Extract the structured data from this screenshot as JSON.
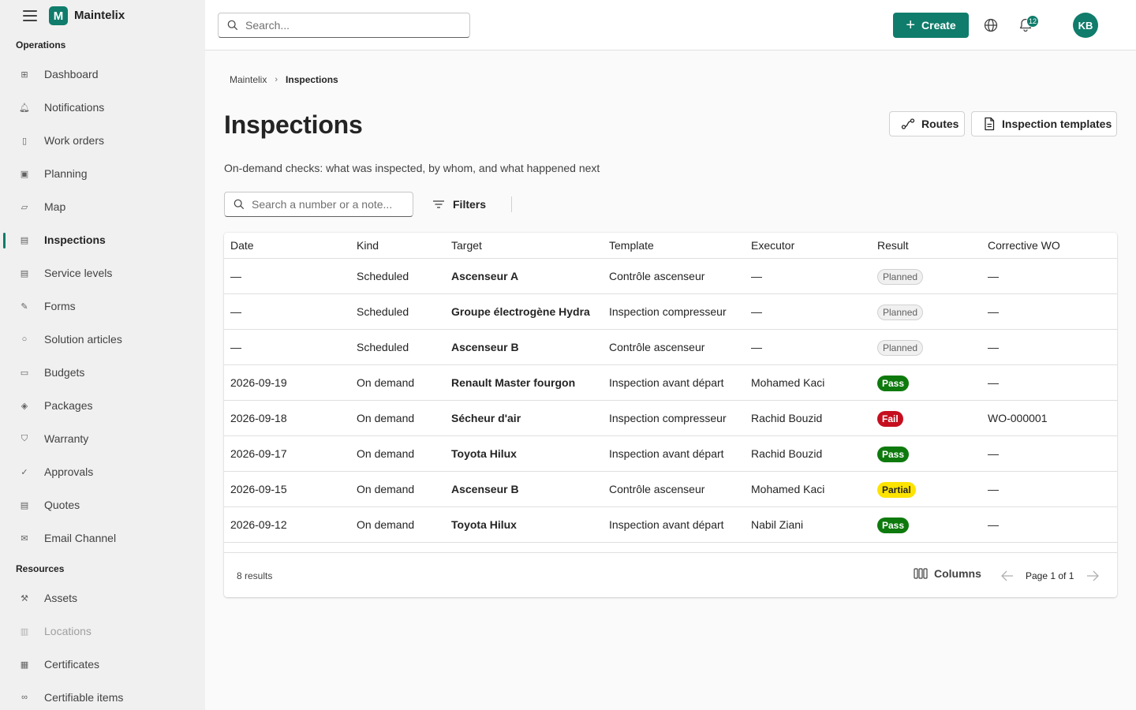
{
  "app": {
    "name": "Maintelix",
    "logo_letter": "M",
    "brand_color": "#107c6b"
  },
  "sidebar": {
    "operations_label": "Operations",
    "resources_label": "Resources",
    "operations": [
      {
        "label": "Dashboard",
        "icon": "dashboard-icon"
      },
      {
        "label": "Notifications",
        "icon": "bell-icon"
      },
      {
        "label": "Work orders",
        "icon": "clipboard-icon"
      },
      {
        "label": "Planning",
        "icon": "calendar-icon"
      },
      {
        "label": "Map",
        "icon": "map-icon"
      },
      {
        "label": "Inspections",
        "icon": "document-icon"
      },
      {
        "label": "Service levels",
        "icon": "document-icon"
      },
      {
        "label": "Forms",
        "icon": "form-icon"
      },
      {
        "label": "Solution articles",
        "icon": "lightbulb-icon"
      },
      {
        "label": "Budgets",
        "icon": "money-icon"
      },
      {
        "label": "Packages",
        "icon": "package-icon"
      },
      {
        "label": "Warranty",
        "icon": "shield-icon"
      },
      {
        "label": "Approvals",
        "icon": "check-circle-icon"
      },
      {
        "label": "Quotes",
        "icon": "document-icon"
      },
      {
        "label": "Email Channel",
        "icon": "mail-icon"
      }
    ],
    "resources": [
      {
        "label": "Assets",
        "icon": "wrench-icon"
      },
      {
        "label": "Locations",
        "icon": "building-icon"
      },
      {
        "label": "Certificates",
        "icon": "certificate-icon"
      },
      {
        "label": "Certifiable items",
        "icon": "link-icon"
      }
    ]
  },
  "topbar": {
    "search_placeholder": "Search...",
    "create_label": "Create",
    "notifications_count": "12",
    "avatar_initials": "KB"
  },
  "breadcrumb": {
    "root": "Maintelix",
    "current": "Inspections"
  },
  "page": {
    "title": "Inspections",
    "description": "On-demand checks: what was inspected, by whom, and what happened next",
    "routes_label": "Routes",
    "templates_label": "Inspection templates"
  },
  "filters": {
    "search_placeholder": "Search a number or a note...",
    "filters_label": "Filters"
  },
  "table": {
    "columns": [
      "Date",
      "Kind",
      "Target",
      "Template",
      "Executor",
      "Result",
      "Corrective WO"
    ],
    "rows": [
      {
        "date": "—",
        "kind": "Scheduled",
        "target": "Ascenseur A",
        "template": "Contrôle ascenseur",
        "executor": "—",
        "result": "Planned",
        "result_type": "planned",
        "wo": "—"
      },
      {
        "date": "—",
        "kind": "Scheduled",
        "target": "Groupe électrogène Hydra",
        "template": "Inspection compresseur",
        "executor": "—",
        "result": "Planned",
        "result_type": "planned",
        "wo": "—"
      },
      {
        "date": "—",
        "kind": "Scheduled",
        "target": "Ascenseur B",
        "template": "Contrôle ascenseur",
        "executor": "—",
        "result": "Planned",
        "result_type": "planned",
        "wo": "—"
      },
      {
        "date": "2026-09-19",
        "kind": "On demand",
        "target": "Renault Master fourgon",
        "template": "Inspection avant départ",
        "executor": "Mohamed Kaci",
        "result": "Pass",
        "result_type": "pass",
        "wo": "—"
      },
      {
        "date": "2026-09-18",
        "kind": "On demand",
        "target": "Sécheur d'air",
        "template": "Inspection compresseur",
        "executor": "Rachid Bouzid",
        "result": "Fail",
        "result_type": "fail",
        "wo": "WO-000001"
      },
      {
        "date": "2026-09-17",
        "kind": "On demand",
        "target": "Toyota Hilux",
        "template": "Inspection avant départ",
        "executor": "Rachid Bouzid",
        "result": "Pass",
        "result_type": "pass",
        "wo": "—"
      },
      {
        "date": "2026-09-15",
        "kind": "On demand",
        "target": "Ascenseur B",
        "template": "Contrôle ascenseur",
        "executor": "Mohamed Kaci",
        "result": "Partial",
        "result_type": "partial",
        "wo": "—"
      },
      {
        "date": "2026-09-12",
        "kind": "On demand",
        "target": "Toyota Hilux",
        "template": "Inspection avant départ",
        "executor": "Nabil Ziani",
        "result": "Pass",
        "result_type": "pass",
        "wo": "—"
      }
    ],
    "results_text": "8 results",
    "columns_label": "Columns",
    "page_text": "Page 1 of 1"
  }
}
